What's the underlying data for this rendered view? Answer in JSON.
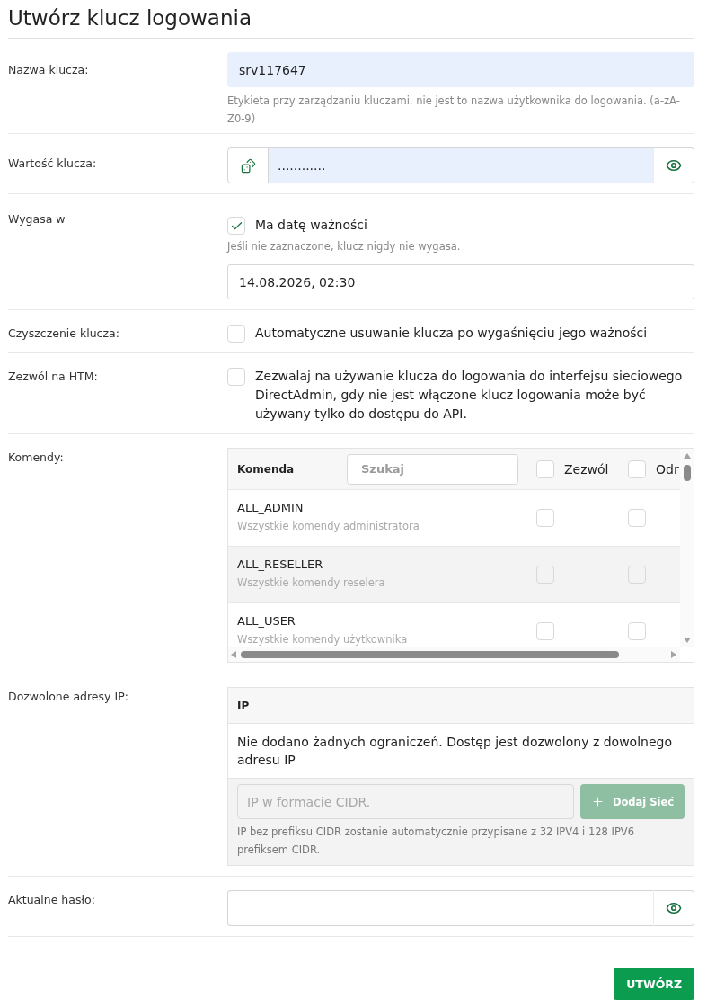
{
  "title": "Utwórz klucz logowania",
  "rows": [
    {
      "kind": "text",
      "label": "Nazwa klucza:",
      "value": "srv117647",
      "autofilled": true,
      "hint": "Etykieta przy zarządzaniu kluczami, nie jest to nazwa użytkownika do logowania. (a-zA-Z0-9)"
    },
    {
      "kind": "secret",
      "label": "Wartość klucza:",
      "value": "............",
      "autofilled": true
    },
    {
      "kind": "expiry",
      "label": "Wygasa w",
      "checkbox": {
        "label": "Ma datę ważności",
        "checked": true
      },
      "hint": "Jeśli nie zaznaczone, klucz nigdy nie wygasa.",
      "value": "14.08.2026, 02:30"
    },
    {
      "kind": "checkbox",
      "label": "Czyszczenie klucza:",
      "checkbox": {
        "label": "Automatyczne usuwanie klucza po wygaśnięciu jego ważności",
        "checked": false
      }
    },
    {
      "kind": "checkbox",
      "label": "Zezwól na HTM:",
      "checkbox": {
        "label": "Zezwalaj na używanie klucza do logowania do interfejsu sieciowego DirectAdmin, gdy nie jest włączone klucz logowania może być używany tylko do dostępu do API.",
        "checked": false
      }
    },
    {
      "kind": "commands",
      "label": "Komendy:",
      "table": {
        "column_1": "Komenda",
        "search": {
          "placeholder": "Szukaj"
        },
        "check_columns": [
          {
            "label": "Zezwól",
            "checked": false
          },
          {
            "label": "Odr",
            "checked": false
          }
        ],
        "rows": [
          {
            "name": "ALL_ADMIN",
            "description": "Wszystkie komendy administratora",
            "checks": [
              {
                "checked": false
              },
              {
                "checked": false
              }
            ]
          },
          {
            "name": "ALL_RESELLER",
            "description": "Wszystkie komendy reselera",
            "checks": [
              {
                "checked": false
              },
              {
                "checked": false
              }
            ]
          },
          {
            "name": "ALL_USER",
            "description": "Wszystkie komendy użytkownika",
            "checks": [
              {
                "checked": false
              },
              {
                "checked": false
              }
            ]
          }
        ]
      }
    },
    {
      "kind": "ip",
      "label": "Dozwolone adresy IP:",
      "table": {
        "column_1": "IP",
        "empty_message": "Nie dodano żadnych ograniczeń. Dostęp jest dozwolony z dowolnego adresu IP",
        "input": {
          "placeholder": "IP w formacie CIDR."
        },
        "add_button": {
          "label": "Dodaj Sieć",
          "disabled": true
        },
        "hint": "IP bez prefiksu CIDR zostanie automatycznie przypisane z 32 IPV4 i 128 IPV6 prefiksem CIDR."
      }
    },
    {
      "kind": "password",
      "label": "Aktualne hasło:"
    }
  ],
  "submit": {
    "label": "UTWÓRZ"
  }
}
